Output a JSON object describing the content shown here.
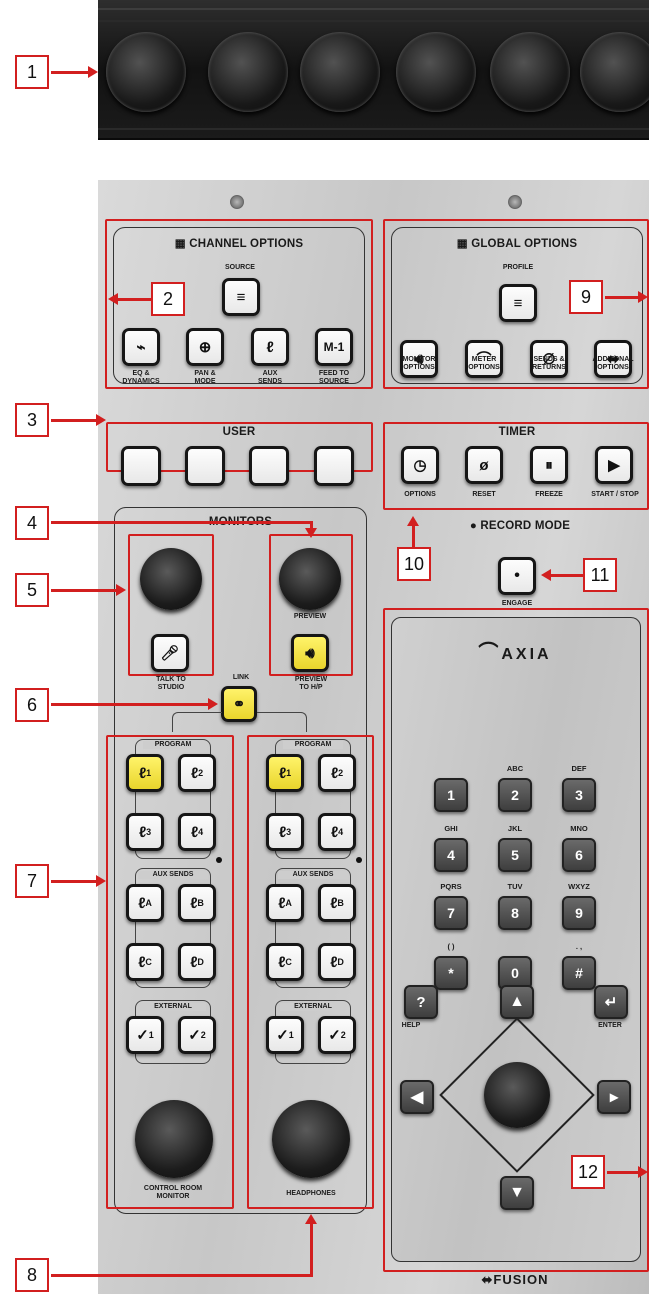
{
  "callouts": [
    "1",
    "2",
    "3",
    "4",
    "5",
    "6",
    "7",
    "8",
    "9",
    "10",
    "11",
    "12"
  ],
  "channel_options": {
    "title": "CHANNEL OPTIONS",
    "source_label": "SOURCE",
    "buttons": [
      "EQ &\nDYNAMICS",
      "PAN &\nMODE",
      "AUX\nSENDS",
      "FEED TO\nSOURCE"
    ],
    "feed_symbol": "M-1"
  },
  "global_options": {
    "title": "GLOBAL OPTIONS",
    "profile_label": "PROFILE",
    "buttons": [
      "MONITOR\nOPTIONS",
      "METER\nOPTIONS",
      "SENDS &\nRETURNS",
      "ADDITONAL\nOPTIONS"
    ]
  },
  "user": {
    "title": "USER"
  },
  "timer": {
    "title": "TIMER",
    "buttons": [
      "OPTIONS",
      "RESET",
      "FREEZE",
      "START / STOP"
    ]
  },
  "record_mode": {
    "title": "RECORD MODE",
    "engage_label": "ENGAGE"
  },
  "monitors": {
    "title": "MONITORS",
    "preview_label": "PREVIEW",
    "talk_label": "TALK TO\nSTUDIO",
    "preview_hp_label": "PREVIEW\nTO H/P",
    "link_label": "LINK",
    "program_label": "PROGRAM",
    "aux_label": "AUX SENDS",
    "external_label": "EXTERNAL",
    "program_subs": [
      "1",
      "2",
      "3",
      "4"
    ],
    "aux_subs": [
      "A",
      "B",
      "C",
      "D"
    ],
    "external_subs": [
      "1",
      "2"
    ],
    "control_room_label": "CONTROL ROOM\nMONITOR",
    "headphones_label": "HEADPHONES"
  },
  "keypad": {
    "logo": "AXIA",
    "keys": [
      "1",
      "2",
      "3",
      "4",
      "5",
      "6",
      "7",
      "8",
      "9",
      "*",
      "0",
      "#"
    ],
    "letters": [
      "",
      "ABC",
      "DEF",
      "GHI",
      "JKL",
      "MNO",
      "PQRS",
      "TUV",
      "WXYZ",
      "( )",
      "",
      ". ,"
    ],
    "help_label": "HELP",
    "enter_label": "ENTER",
    "help_symbol": "?"
  },
  "brand": "FUSION",
  "colors": {
    "callout": "#d21f1f",
    "highlight": "#f2e03a",
    "panel": "#cfcfcf"
  }
}
